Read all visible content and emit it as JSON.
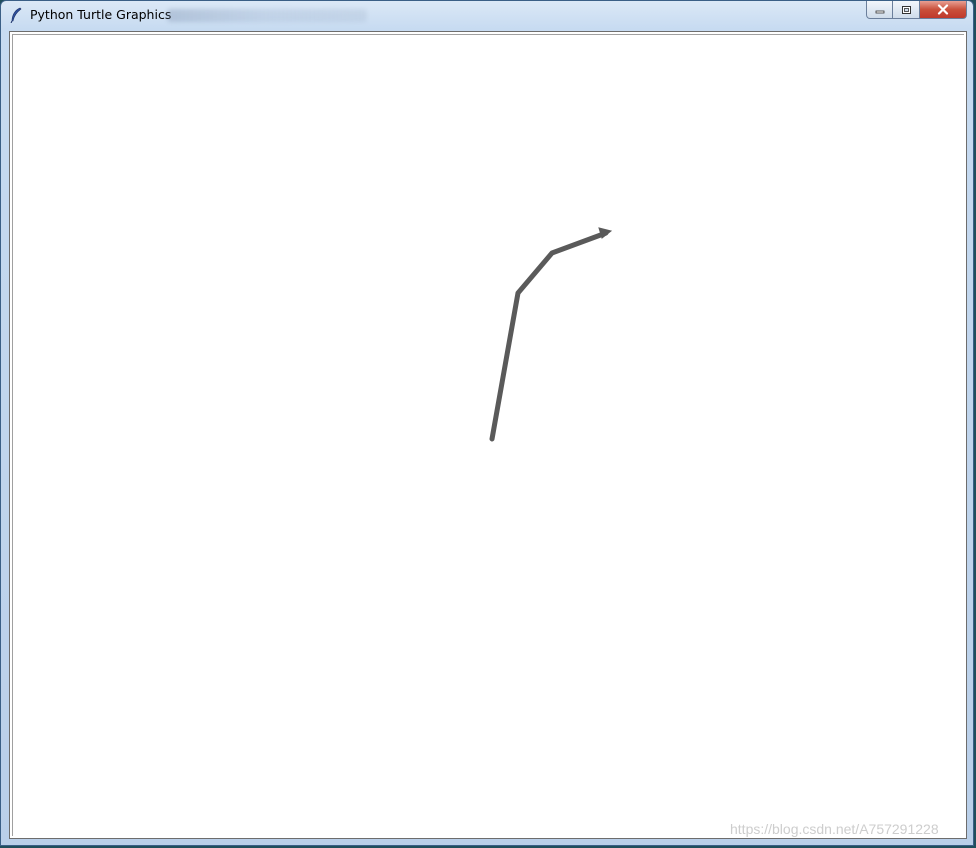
{
  "window": {
    "title": "Python Turtle Graphics",
    "icon": "feather-icon",
    "controls": {
      "minimize_icon": "minimize-icon",
      "maximize_icon": "maximize-icon",
      "close_icon": "close-icon"
    }
  },
  "canvas": {
    "background": "#ffffff",
    "pen_color": "#5a5a5a",
    "turtle_shape": "arrow"
  },
  "watermark": {
    "text": "https://blog.csdn.net/A757291228"
  },
  "colors": {
    "close_button": "#c9503b",
    "titlebar": "#c7dbf1"
  }
}
